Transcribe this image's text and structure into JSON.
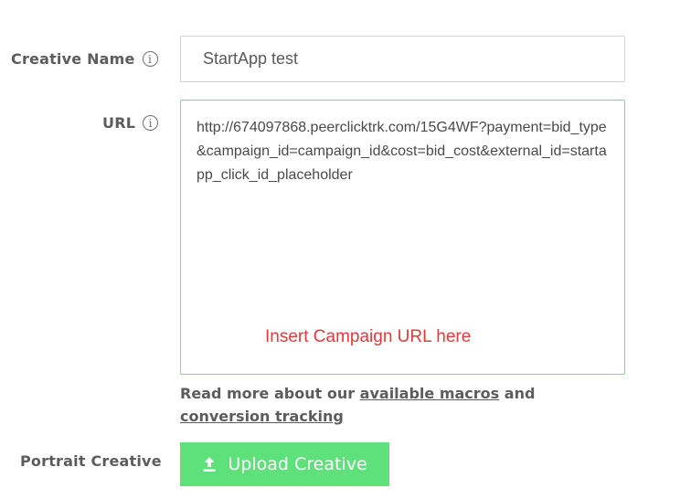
{
  "creative_name": {
    "label": "Creative Name",
    "value": "StartApp test"
  },
  "url": {
    "label": "URL",
    "value": "http://674097868.peerclicktrk.com/15G4WF?payment=bid_type&campaign_id=campaign_id&cost=bid_cost&external_id=startapp_click_id_placeholder",
    "note": "Insert Campaign URL here"
  },
  "help": {
    "prefix": "Read more about our",
    "macros_link": "available macros",
    "middle": "and",
    "tracking_link": "conversion tracking"
  },
  "portrait": {
    "label": "Portrait Creative",
    "button_label": "Upload Creative"
  },
  "icons": {
    "info": "info-icon",
    "upload": "upload-icon"
  },
  "colors": {
    "upload_button": "#5ee07a",
    "url_border": "#7bdc8e",
    "note_text": "#e03a3a"
  }
}
